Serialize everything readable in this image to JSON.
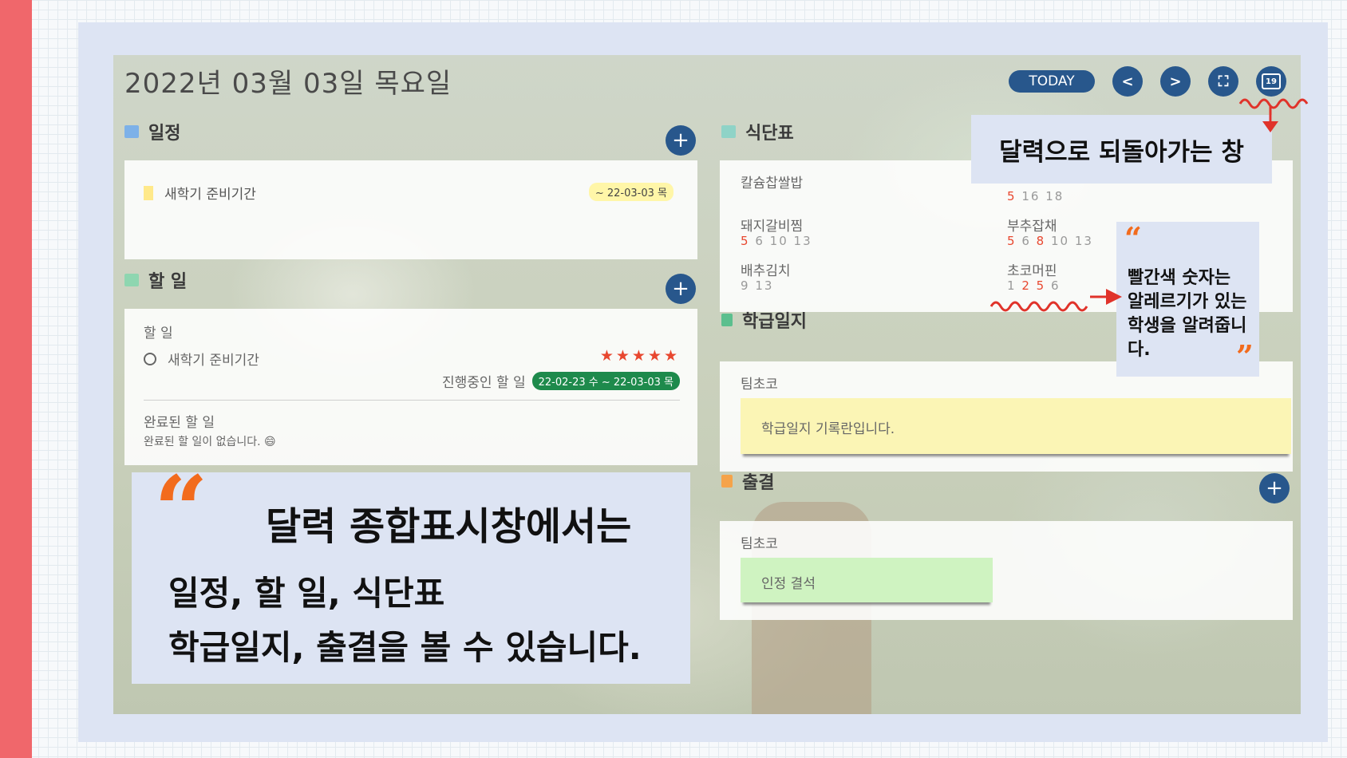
{
  "header": {
    "date_title": "2022년 03월 03일 목요일",
    "today_label": "TODAY",
    "prev_icon": "<",
    "next_icon": ">",
    "fullscreen_icon": "⛶",
    "calendar_icon": "19"
  },
  "schedule": {
    "title": "일정",
    "item_label": "새학기 준비기간",
    "item_date": "~ 22-03-03 목"
  },
  "todo": {
    "title": "할 일",
    "list_heading": "할 일",
    "item_label": "새학기 준비기간",
    "stars": "★★★★★",
    "progress_label": "진행중인 할 일",
    "progress_range": "22-02-23 수 ~ 22-03-03 목",
    "completed_heading": "완료된 할 일",
    "completed_empty": "완료된 할 일이 없습니다. 😄"
  },
  "menu": {
    "title": "식단표",
    "items": [
      {
        "name": "칼슘찹쌀밥"
      },
      {
        "name": "돼지갈비찜",
        "allergens": [
          {
            "n": "5",
            "red": true
          },
          {
            "n": "6",
            "red": false
          },
          {
            "n": "10",
            "red": false
          },
          {
            "n": "13",
            "red": false
          }
        ]
      },
      {
        "name": "배추김치",
        "allergens": [
          {
            "n": "9",
            "red": false
          },
          {
            "n": "13",
            "red": false
          }
        ]
      },
      {
        "name": "부추잡채",
        "allergens": [
          {
            "n": "5",
            "red": true
          },
          {
            "n": "6",
            "red": false
          },
          {
            "n": "8",
            "red": true
          },
          {
            "n": "10",
            "red": false
          },
          {
            "n": "13",
            "red": false
          }
        ]
      },
      {
        "name": "초코머핀",
        "allergens": [
          {
            "n": "1",
            "red": false
          },
          {
            "n": "2",
            "red": true
          },
          {
            "n": "5",
            "red": true
          },
          {
            "n": "6",
            "red": false
          }
        ]
      }
    ],
    "partial_row": [
      {
        "n": "5",
        "red": true
      },
      {
        "n": "16",
        "red": false
      },
      {
        "n": "18",
        "red": false
      }
    ]
  },
  "class_log": {
    "title": "학급일지",
    "author": "팀초코",
    "note": "학급일지 기록란입니다."
  },
  "attendance": {
    "title": "출결",
    "author": "팀초코",
    "status": "인정 결석"
  },
  "caption": {
    "line1": "달력 종합표시창에서는",
    "line2": "일정, 할 일, 식단표",
    "line3": "학급일지, 출결을 볼 수 있습니다."
  },
  "callouts": {
    "calendar_return": "달력으로 되돌아가는 창",
    "allergy_line1": "빨간색 숫자는",
    "allergy_line2": "알레르기가 있는",
    "allergy_line3": "학생을 알려줍니다."
  },
  "colors": {
    "accent": "#28578c",
    "allergy_red": "#e8472f",
    "side_strip": "#f0676b",
    "quote_orange": "#f26b1d"
  }
}
